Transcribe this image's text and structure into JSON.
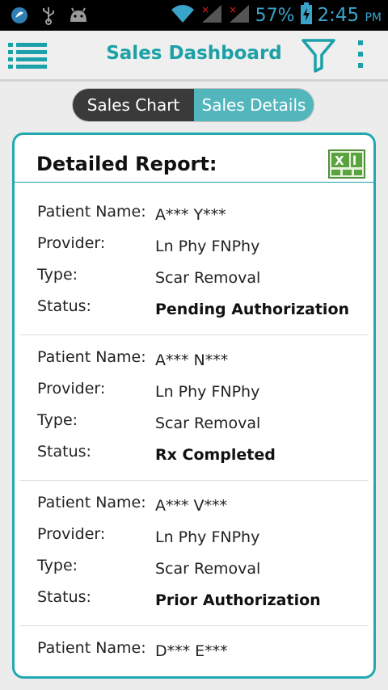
{
  "status_bar": {
    "battery": "57%",
    "time": "2:45",
    "ampm": "PM",
    "icons": [
      "app-icon",
      "usb-icon",
      "android-icon",
      "wifi-icon",
      "signal-icon",
      "signal-icon",
      "battery-icon"
    ]
  },
  "app_bar": {
    "title": "Sales Dashboard",
    "icons": [
      "menu-icon",
      "filter-icon",
      "overflow-menu-icon"
    ]
  },
  "tabs": [
    {
      "label": "Sales Chart",
      "selected": false
    },
    {
      "label": "Sales Details",
      "selected": true
    }
  ],
  "report": {
    "title": "Detailed Report:",
    "export_icon": "excel-icon",
    "labels": {
      "patient": "Patient Name:",
      "provider": "Provider:",
      "type": "Type:",
      "status": "Status:"
    },
    "records": [
      {
        "patient": "A*** Y***",
        "provider": "Ln Phy FNPhy",
        "type": "Scar Removal",
        "status": "Pending Authorization"
      },
      {
        "patient": "A*** N***",
        "provider": "Ln Phy FNPhy",
        "type": "Scar Removal",
        "status": "Rx Completed"
      },
      {
        "patient": "A*** V***",
        "provider": "Ln Phy FNPhy",
        "type": "Scar Removal",
        "status": "Prior Authorization"
      },
      {
        "patient": "D*** E***"
      }
    ]
  },
  "colors": {
    "accent": "#1ba1a7",
    "segment_selected": "#53b6bd",
    "segment_unselected": "#3a3a3a",
    "status_bar_text": "#3aa3c9"
  }
}
